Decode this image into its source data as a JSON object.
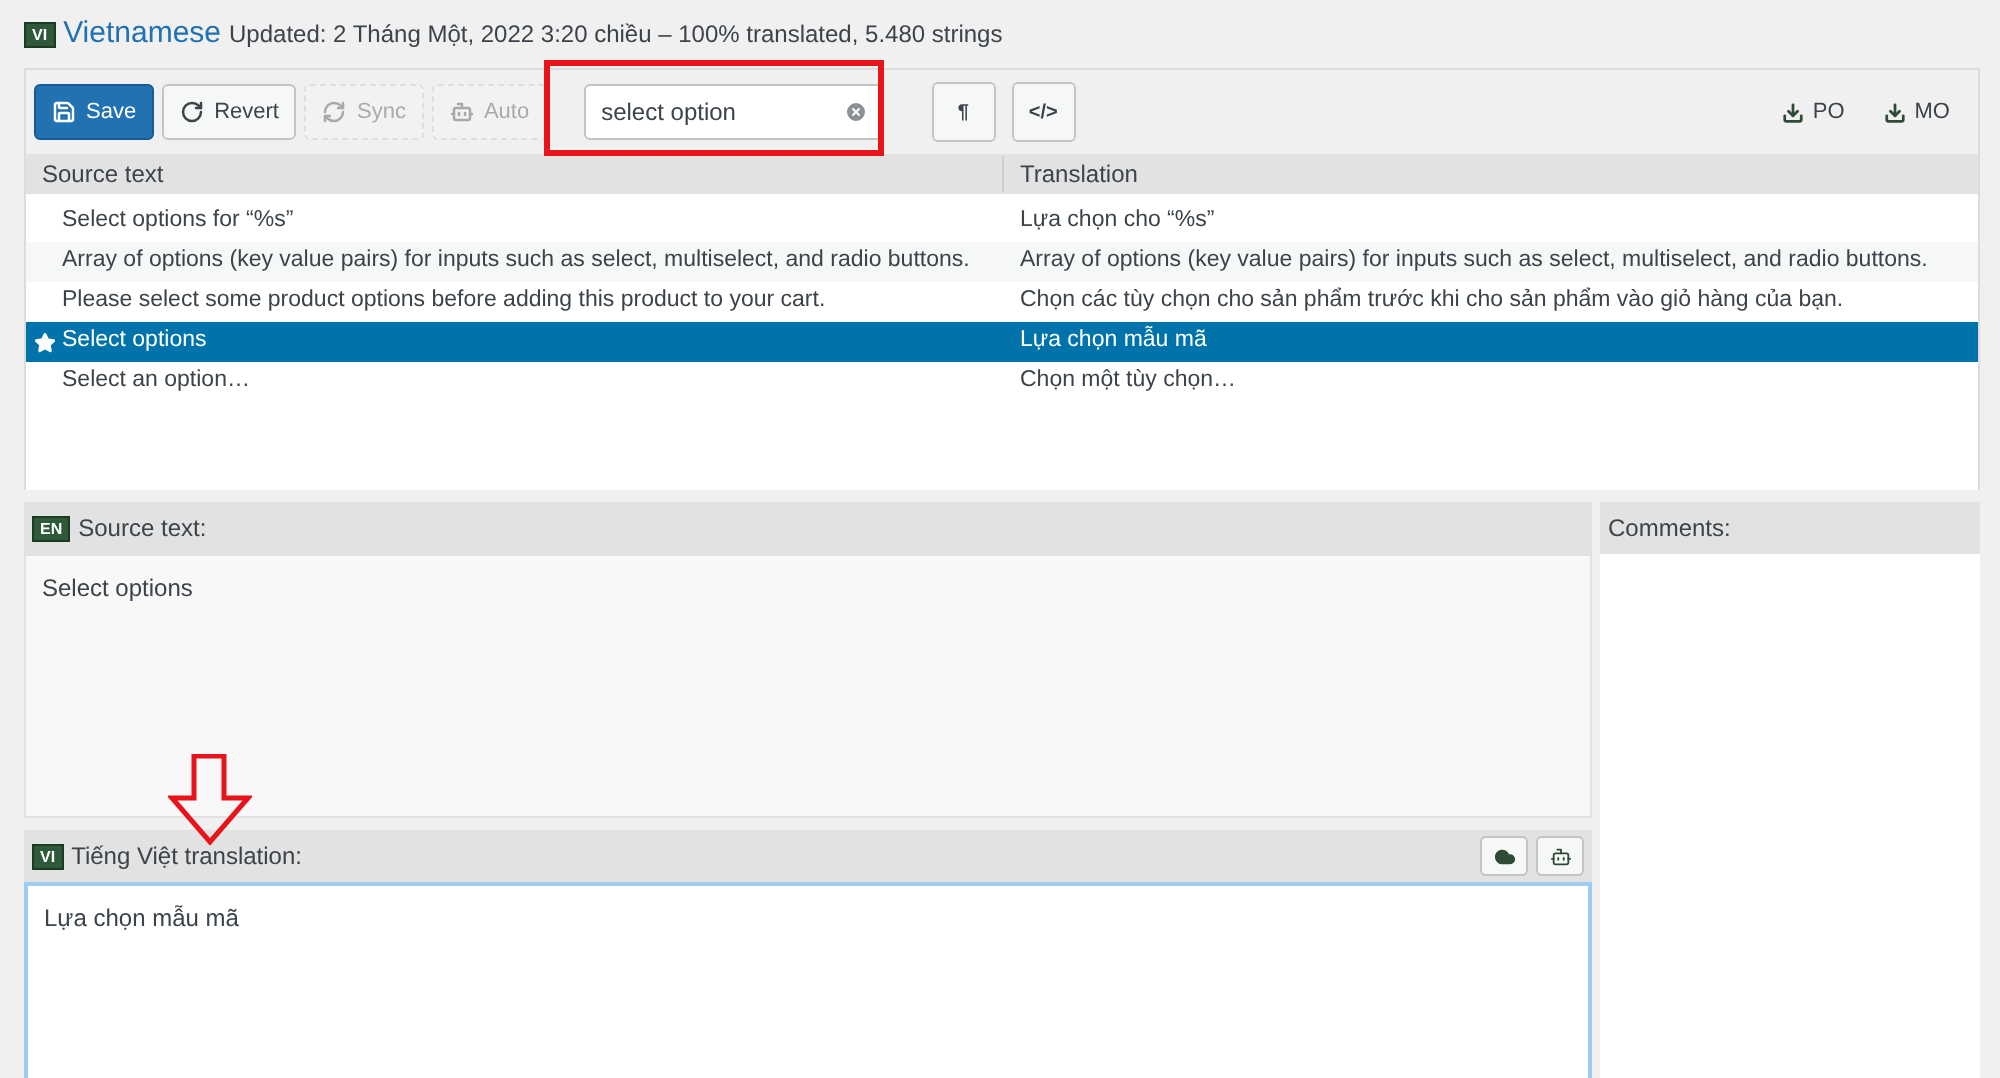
{
  "header": {
    "language_code": "VI",
    "language": "Vietnamese",
    "status": "Updated: 2 Tháng Một, 2022 3:20 chiều – 100% translated, 5.480 strings"
  },
  "toolbar": {
    "buttons": [
      {
        "label": "Save",
        "kind": "save",
        "primary": true,
        "disabled": false
      },
      {
        "label": "Revert",
        "kind": "revert",
        "primary": false,
        "disabled": false
      },
      {
        "label": "Sync",
        "kind": "sync",
        "primary": false,
        "disabled": true
      },
      {
        "label": "Auto",
        "kind": "auto",
        "primary": false,
        "disabled": true
      }
    ],
    "search": {
      "value": "select option"
    },
    "toggles": [
      "¶",
      "</>"
    ],
    "downloads": [
      "PO",
      "MO"
    ]
  },
  "table": {
    "columns": [
      "Source text",
      "Translation"
    ],
    "rows": [
      {
        "source": "Select options for “%s”",
        "translation": "Lựa chọn cho “%s”",
        "selected": false
      },
      {
        "source": "Array of options (key value pairs) for inputs such as select, multiselect, and radio buttons.",
        "translation": "Array of options (key value pairs) for inputs such as select, multiselect, and radio buttons.",
        "selected": false
      },
      {
        "source": "Please select some product options before adding this product to your cart.",
        "translation": "Chọn các tùy chọn cho sản phẩm trước khi cho sản phẩm vào giỏ hàng của bạn.",
        "selected": false
      },
      {
        "source": "Select options",
        "translation": "Lựa chọn mẫu mã",
        "selected": true
      },
      {
        "source": "Select an option…",
        "translation": "Chọn một tùy chọn…",
        "selected": false
      }
    ]
  },
  "source_panel": {
    "language_code": "EN",
    "label": "Source text:",
    "text": "Select options"
  },
  "translation_panel": {
    "language_code": "VI",
    "label": "Tiếng Việt translation:",
    "value": "Lựa chọn mẫu mã"
  },
  "comments_panel": {
    "label": "Comments:"
  }
}
